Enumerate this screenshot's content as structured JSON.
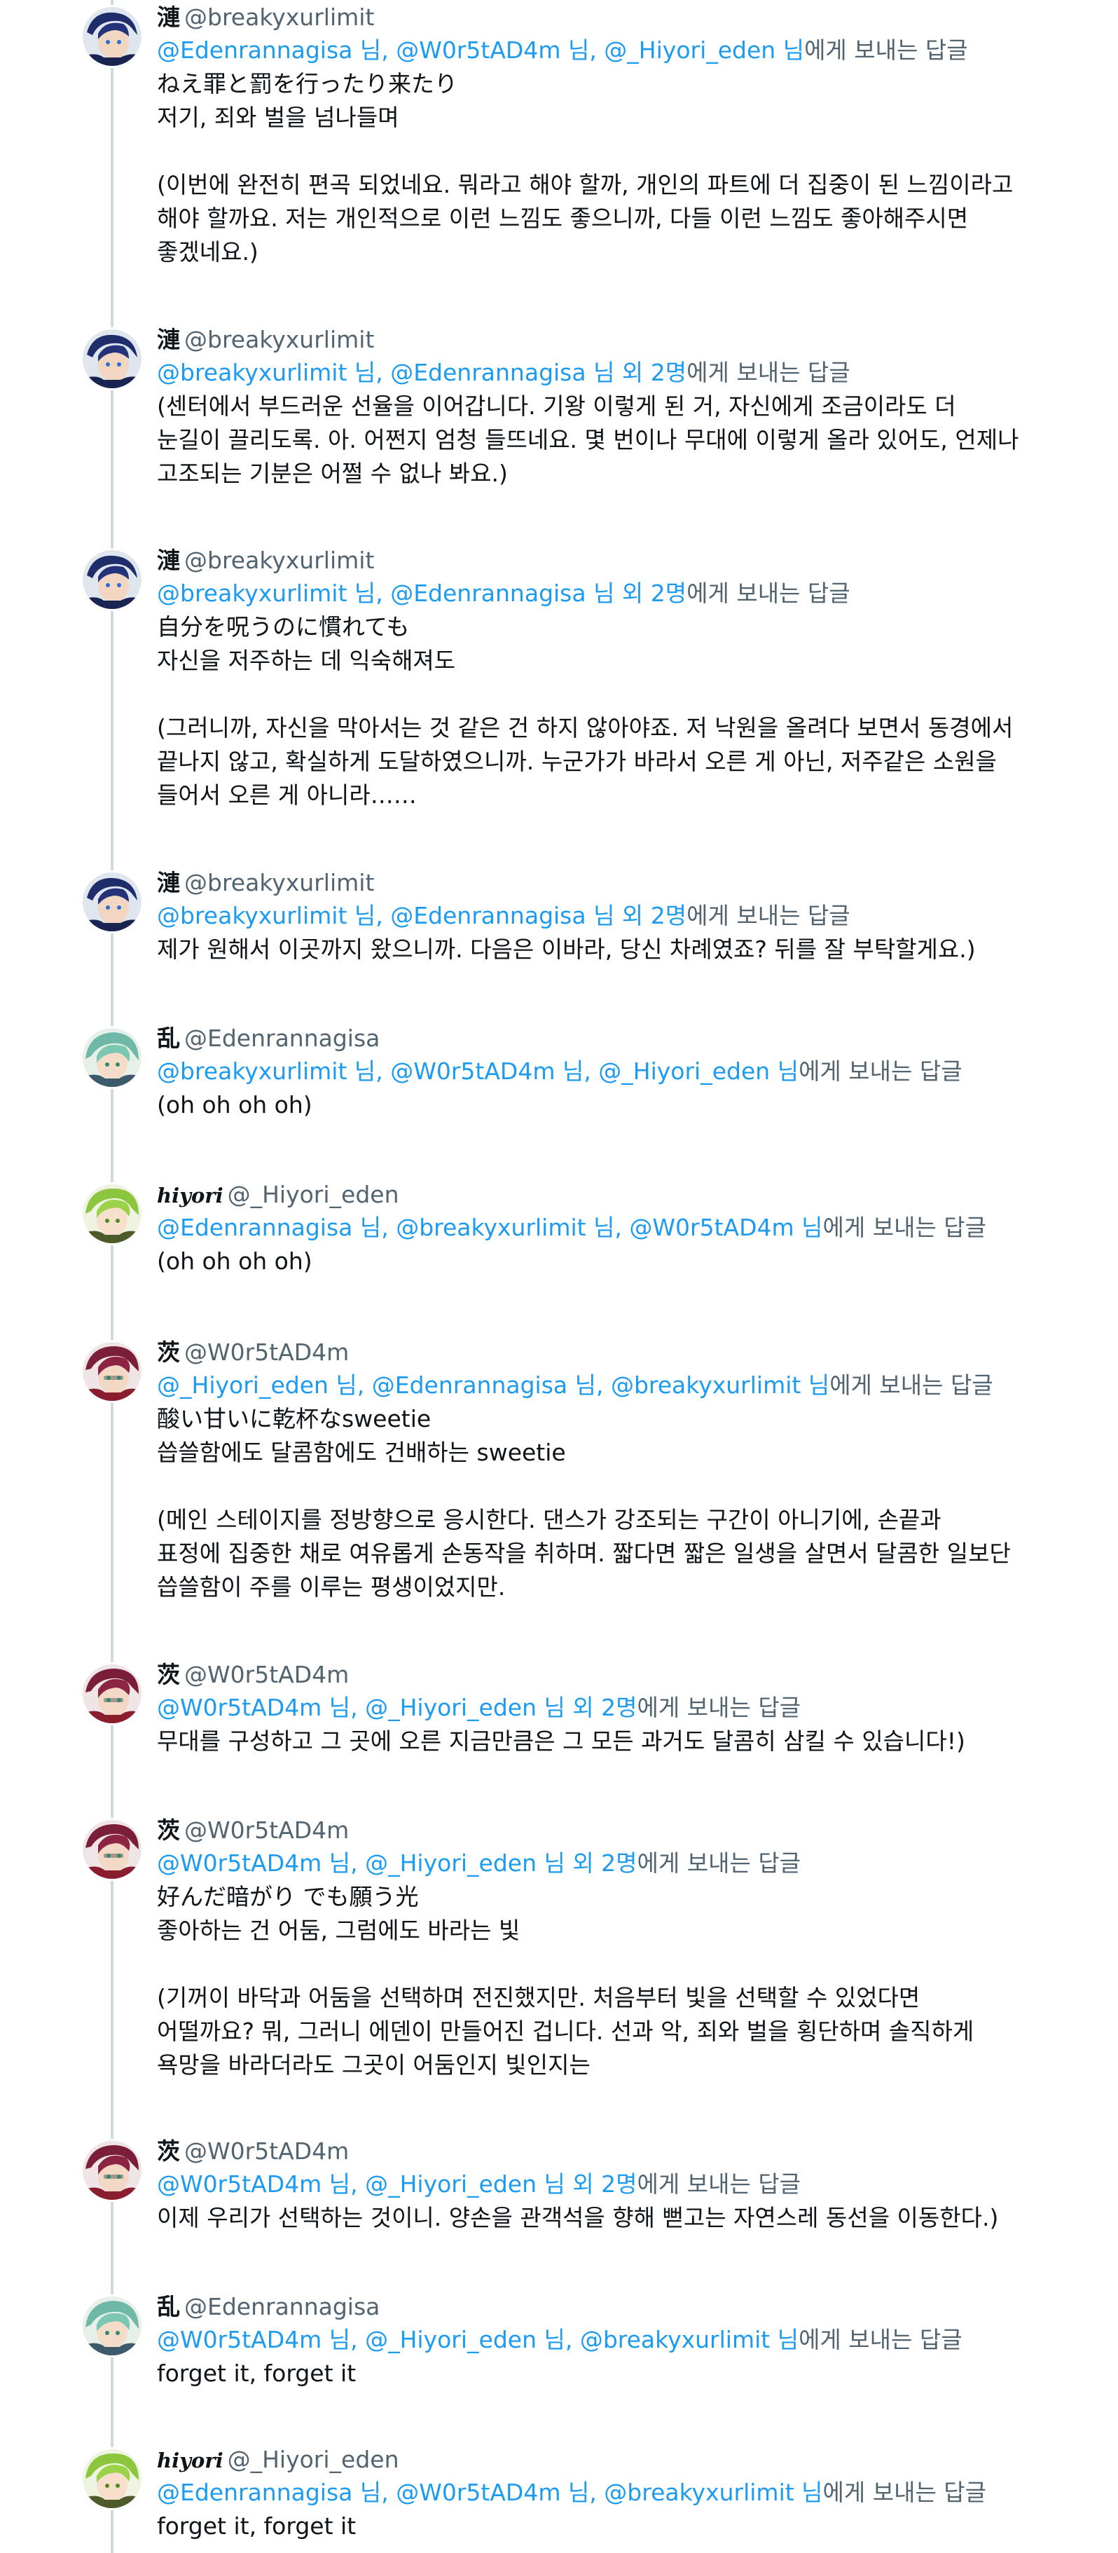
{
  "colors": {
    "link": "#1d9bf0",
    "muted": "#536471",
    "text": "#0f1419",
    "thread_line": "#cfd9de"
  },
  "tweets": [
    {
      "name": "漣",
      "handle": "@breakyxurlimit",
      "mentions": "@Edenrannagisa 님, @W0r5tAD4m 님, @_Hiyori_eden 님",
      "reply_suffix": "에게 보내는 답글",
      "text": "ねえ罪と罰を行ったり来たり\n저기, 죄와 벌을 넘나들며\n\n(이번에 완전히 편곡 되었네요. 뭐라고 해야 할까, 개인의 파트에 더 집중이 된 느낌이라고\n해야 할까요. 저는 개인적으로 이런 느낌도 좋으니까, 다들 이런 느낌도 좋아해주시면\n좋겠네요.)",
      "avatar": "blue-avatar"
    },
    {
      "name": "漣",
      "handle": "@breakyxurlimit",
      "mentions": "@breakyxurlimit 님, @Edenrannagisa 님 외 2명",
      "reply_suffix": "에게 보내는 답글",
      "text": "(센터에서 부드러운 선율을 이어갑니다. 기왕 이렇게 된 거, 자신에게 조금이라도 더\n눈길이 끌리도록. 아. 어쩐지 엄청 들뜨네요. 몇 번이나 무대에 이렇게 올라 있어도, 언제나\n고조되는 기분은 어쩔 수 없나 봐요.)",
      "avatar": "blue-avatar"
    },
    {
      "name": "漣",
      "handle": "@breakyxurlimit",
      "mentions": "@breakyxurlimit 님, @Edenrannagisa 님 외 2명",
      "reply_suffix": "에게 보내는 답글",
      "text": "自分を呪うのに慣れても\n자신을 저주하는 데 익숙해져도\n\n(그러니까, 자신을 막아서는 것 같은 건 하지 않아야죠. 저 낙원을 올려다 보면서 동경에서\n끝나지 않고, 확실하게 도달하였으니까. 누군가가 바라서 오른 게 아닌, 저주같은 소원을\n들어서 오른 게 아니라……",
      "avatar": "blue-avatar"
    },
    {
      "name": "漣",
      "handle": "@breakyxurlimit",
      "mentions": "@breakyxurlimit 님, @Edenrannagisa 님 외 2명",
      "reply_suffix": "에게 보내는 답글",
      "text": "제가 원해서 이곳까지 왔으니까. 다음은 이바라, 당신 차례였죠? 뒤를 잘 부탁할게요.)",
      "avatar": "blue-avatar"
    },
    {
      "name": "乱",
      "handle": "@Edenrannagisa",
      "mentions": "@breakyxurlimit 님, @W0r5tAD4m 님, @_Hiyori_eden 님",
      "reply_suffix": "에게 보내는 답글",
      "text": "(oh oh oh oh)",
      "avatar": "teal-avatar"
    },
    {
      "name": "hiyori",
      "handle": "@_Hiyori_eden",
      "mentions": "@Edenrannagisa 님, @breakyxurlimit 님, @W0r5tAD4m 님",
      "reply_suffix": "에게 보내는 답글",
      "text": "(oh oh oh oh)",
      "avatar": "green-avatar"
    },
    {
      "name": "茨",
      "handle": "@W0r5tAD4m",
      "mentions": "@_Hiyori_eden 님, @Edenrannagisa 님, @breakyxurlimit 님",
      "reply_suffix": "에게 보내는 답글",
      "text": "酸い甘いに乾杯なsweetie\n씁쓸함에도 달콤함에도 건배하는 sweetie\n\n(메인 스테이지를 정방향으로 응시한다. 댄스가 강조되는 구간이 아니기에, 손끝과\n표정에 집중한 채로 여유롭게 손동작을 취하며. 짧다면 짧은 일생을 살면서 달콤한 일보단\n씁쓸함이 주를 이루는 평생이었지만.",
      "avatar": "red-avatar"
    },
    {
      "name": "茨",
      "handle": "@W0r5tAD4m",
      "mentions": "@W0r5tAD4m 님, @_Hiyori_eden 님 외 2명",
      "reply_suffix": "에게 보내는 답글",
      "text": "무대를 구성하고 그 곳에 오른 지금만큼은 그 모든 과거도 달콤히 삼킬 수 있습니다!)",
      "avatar": "red-avatar"
    },
    {
      "name": "茨",
      "handle": "@W0r5tAD4m",
      "mentions": "@W0r5tAD4m 님, @_Hiyori_eden 님 외 2명",
      "reply_suffix": "에게 보내는 답글",
      "text": "好んだ暗がり でも願う光\n좋아하는 건 어둠, 그럼에도 바라는 빛\n\n(기꺼이 바닥과 어둠을 선택하며 전진했지만. 처음부터 빛을 선택할 수 있었다면\n어떨까요? 뭐, 그러니 에덴이 만들어진 겁니다. 선과 악, 죄와 벌을 횡단하며 솔직하게\n욕망을 바라더라도 그곳이 어둠인지 빛인지는",
      "avatar": "red-avatar"
    },
    {
      "name": "茨",
      "handle": "@W0r5tAD4m",
      "mentions": "@W0r5tAD4m 님, @_Hiyori_eden 님 외 2명",
      "reply_suffix": "에게 보내는 답글",
      "text": "이제 우리가 선택하는 것이니. 양손을 관객석을 향해 뻗고는 자연스레 동선을 이동한다.)",
      "avatar": "red-avatar"
    },
    {
      "name": "乱",
      "handle": "@Edenrannagisa",
      "mentions": "@W0r5tAD4m 님, @_Hiyori_eden 님, @breakyxurlimit 님",
      "reply_suffix": "에게 보내는 답글",
      "text": "forget it, forget it",
      "avatar": "teal-avatar"
    },
    {
      "name": "hiyori",
      "handle": "@_Hiyori_eden",
      "mentions": "@Edenrannagisa 님, @W0r5tAD4m 님, @breakyxurlimit 님",
      "reply_suffix": "에게 보내는 답글",
      "text": "forget it, forget it",
      "avatar": "green-avatar"
    }
  ]
}
